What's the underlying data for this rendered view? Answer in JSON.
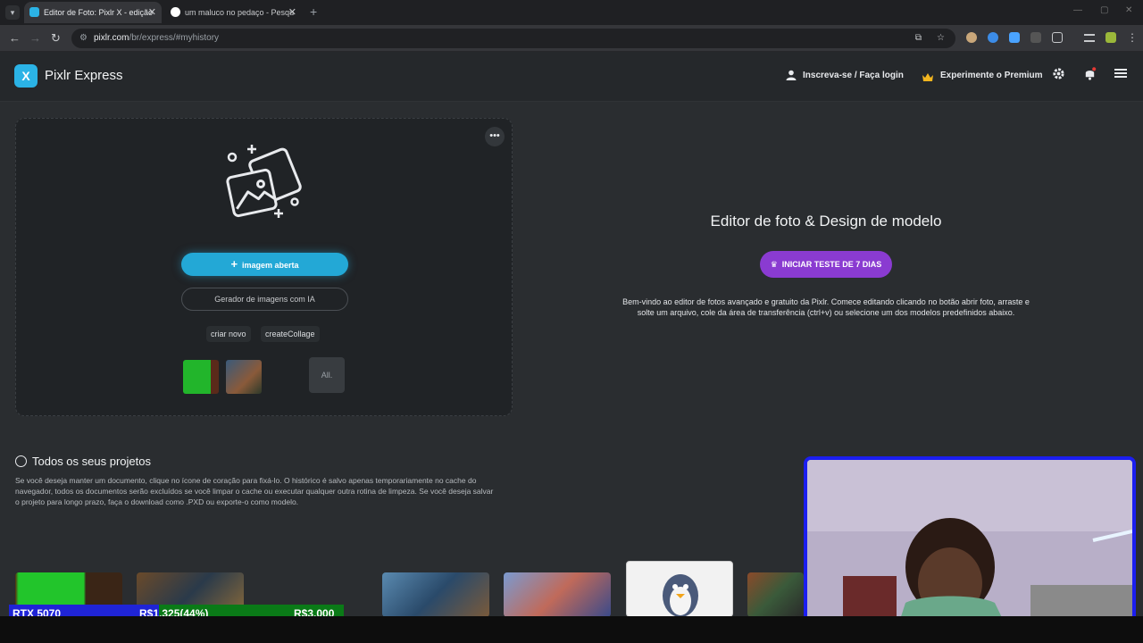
{
  "browser": {
    "tabs": [
      {
        "title": "Editor de Foto: Pixlr X - edição",
        "active": true
      },
      {
        "title": "um maluco no pedaço - Pesqu",
        "active": false
      }
    ],
    "url_host": "pixlr.com",
    "url_path": "/br/express/#myhistory",
    "new_tab": "+",
    "tab_close": "✕",
    "window_controls": [
      "—",
      "▢",
      "✕"
    ]
  },
  "header": {
    "logo_mark": "X",
    "logo_text": "Pixlr Express",
    "login": "Inscreva-se / Faça login",
    "premium": "Experimente o Premium",
    "icons": [
      "user-icon",
      "crown-icon",
      "gear-icon",
      "bell-icon",
      "menu-icon"
    ]
  },
  "open_card": {
    "more": "•••",
    "open_image": "imagem aberta",
    "ai_generator": "Gerador de imagens com IA",
    "create_new": "criar novo",
    "create_collage": "createCollage",
    "all": "All."
  },
  "hero": {
    "title": "Editor de foto & Design de modelo",
    "trial_button": "INICIAR TESTE DE 7 DIAS",
    "description": "Bem-vindo ao editor de fotos avançado e gratuito da Pixlr. Comece editando clicando no botão abrir foto, arraste e solte um arquivo, cole da área de transferência (ctrl+v) ou selecione um dos modelos predefinidos abaixo."
  },
  "projects": {
    "title": "Todos os seus projetos",
    "description": "Se você deseja manter um documento, clique no ícone de coração para fixá-lo. O histórico é salvo apenas temporariamente no cache do navegador, todos os documentos serão excluídos se você limpar o cache ou executar qualquer outra rotina de limpeza. Se você deseja salvar o projeto para longo prazo, faça o download como .PXD ou exporte-o como modelo."
  },
  "overlay": {
    "gpu": "RTX 5070",
    "progress": "R$1,325(44%)",
    "goal": "R$3,000"
  },
  "colors": {
    "accent_blue": "#23a8d6",
    "trial_purple": "#8a3bd1",
    "overlay_green": "#0a7a17",
    "overlay_blue": "#1f24d6"
  }
}
